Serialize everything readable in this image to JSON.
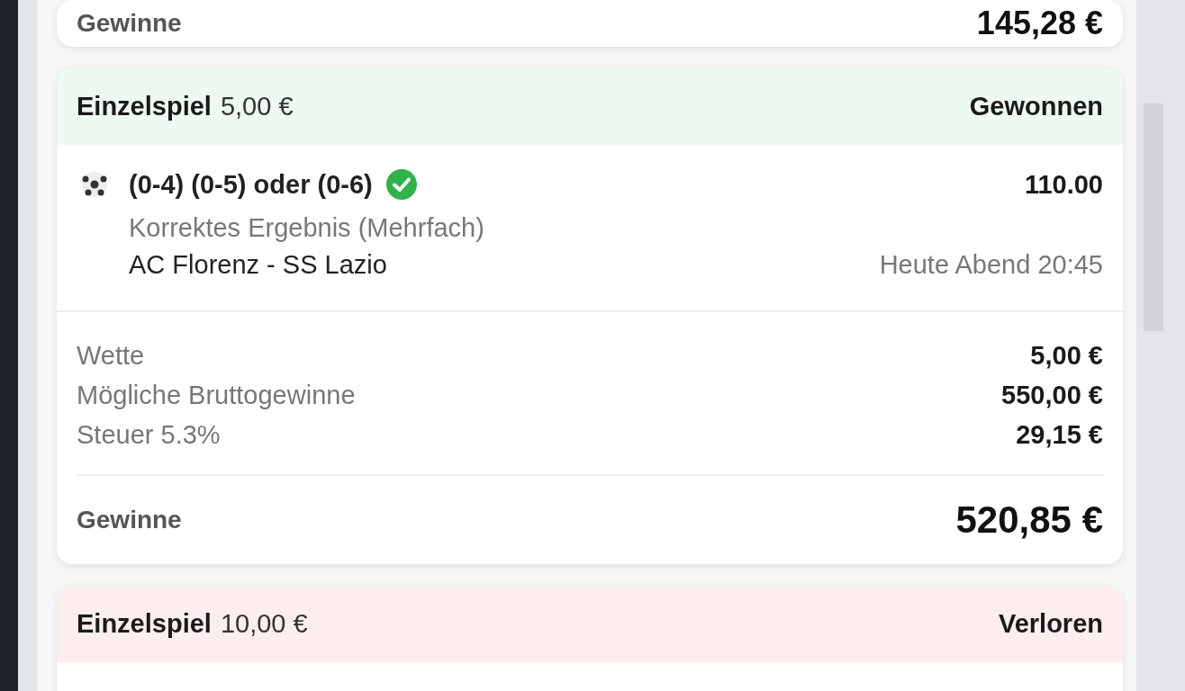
{
  "cards": [
    {
      "kind": "tail",
      "total": {
        "label": "Gewinne",
        "amount": "145,28 €"
      }
    },
    {
      "kind": "bet",
      "type": "Einzelspiel",
      "stake": "5,00 €",
      "status": "Gewonnen",
      "color": "#eefaf1",
      "selections": [
        {
          "pick": "(0-4) (0-5) oder (0-6)",
          "won": true,
          "odds": "110.00",
          "market": "Korrektes Ergebnis (Mehrfach)",
          "event": "AC Florenz - SS Lazio",
          "time": "Heute Abend 20:45"
        }
      ],
      "rows": [
        {
          "label": "Wette",
          "value": "5,00 €"
        },
        {
          "label": "Mögliche Bruttogewinne",
          "value": "550,00 €"
        },
        {
          "label": "Steuer 5.3%",
          "value": "29,15 €"
        }
      ],
      "total": {
        "label": "Gewinne",
        "amount": "520,85 €"
      }
    },
    {
      "kind": "bet",
      "type": "Einzelspiel",
      "stake": "10,00 €",
      "status": "Verloren",
      "color": "#fdeeee"
    }
  ]
}
